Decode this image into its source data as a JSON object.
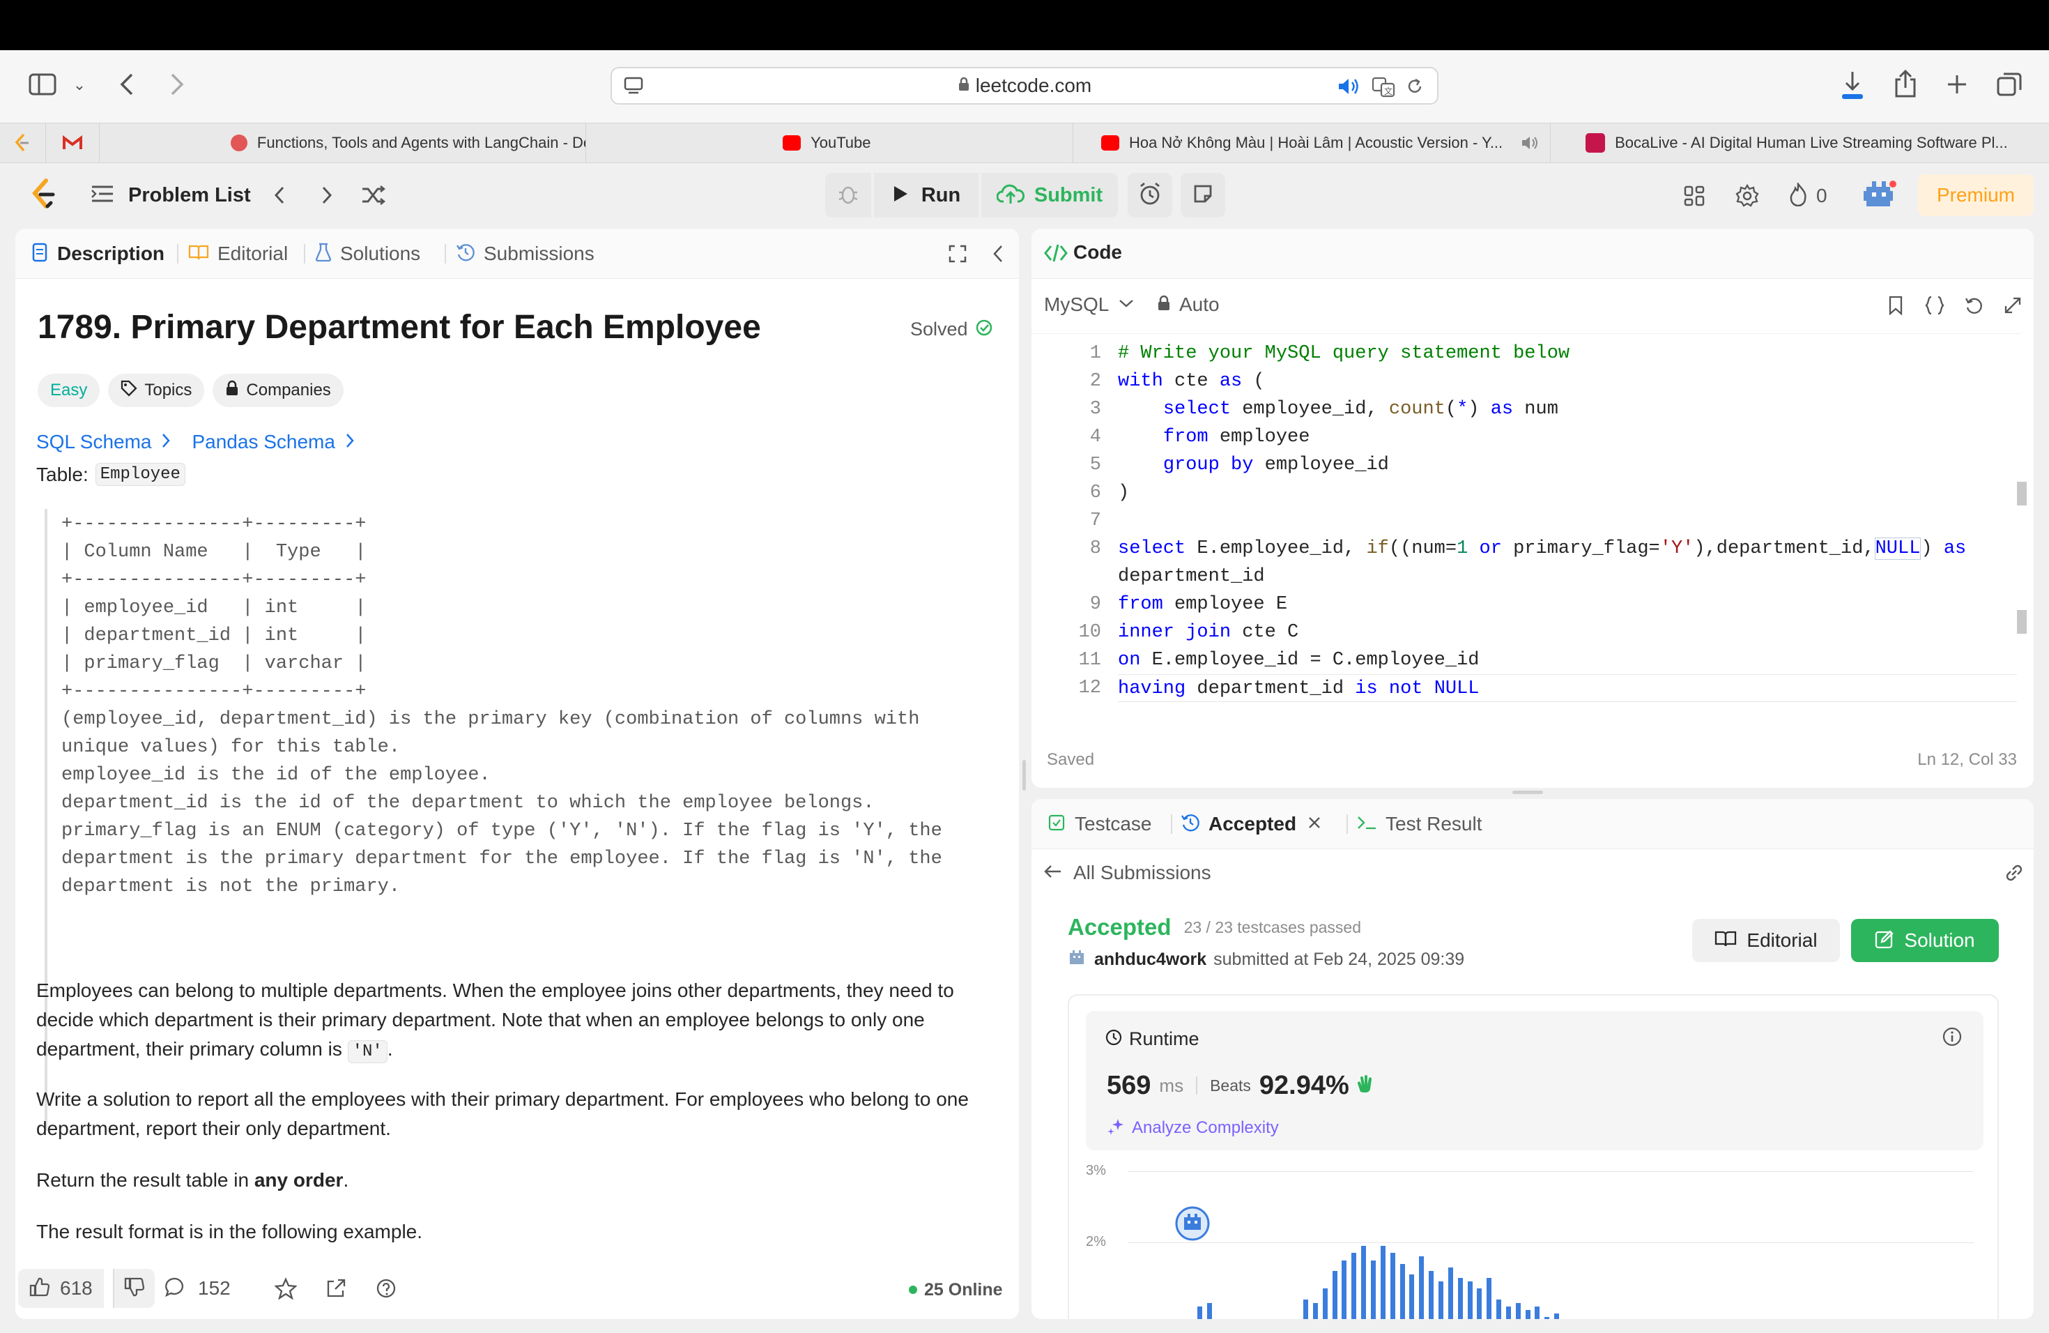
{
  "browser": {
    "url": "leetcode.com",
    "tabs": [
      {
        "label": "Functions, Tools and Agents with LangChain - DeepLear...",
        "color": "#e25656"
      },
      {
        "label": "YouTube",
        "color": "#ff0000"
      },
      {
        "label": "Hoa Nở Không Màu | Hoài Lâm | Acoustic Version - Y...",
        "color": "#ff0000"
      },
      {
        "label": "BocaLive - AI Digital Human Live Streaming Software Pl...",
        "color": "#c4164b"
      }
    ]
  },
  "nav": {
    "problem_list": "Problem List",
    "run": "Run",
    "submit": "Submit",
    "streak": "0",
    "premium": "Premium"
  },
  "left": {
    "tabs": [
      "Description",
      "Editorial",
      "Solutions",
      "Submissions"
    ],
    "title": "1789. Primary Department for Each Employee",
    "solved": "Solved",
    "difficulty": "Easy",
    "topics": "Topics",
    "companies": "Companies",
    "sql_schema": "SQL Schema",
    "pandas_schema": "Pandas Schema",
    "table_label": "Table:",
    "table_name": "Employee",
    "schema_lines": [
      "+---------------+---------+",
      "| Column Name   |  Type   |",
      "+---------------+---------+",
      "| employee_id   | int     |",
      "| department_id | int     |",
      "| primary_flag  | varchar |",
      "+---------------+---------+",
      "(employee_id, department_id) is the primary key (combination of columns with",
      "unique values) for this table.",
      "employee_id is the id of the employee.",
      "department_id is the id of the department to which the employee belongs.",
      "primary_flag is an ENUM (category) of type ('Y', 'N'). If the flag is 'Y', the",
      "department is the primary department for the employee. If the flag is 'N', the",
      "department is not the primary."
    ],
    "para1": "Employees can belong to multiple departments. When the employee joins other departments, they need to decide which department is their primary department. Note that when an employee belongs to only one department, their primary column is",
    "para1_code": "'N'",
    "para2": "Write a solution to report all the employees with their primary department. For employees who belong to one department, report their only department.",
    "para3_pre": "Return the result table in ",
    "para3_bold": "any order",
    "para3_post": ".",
    "para4": "The result format is in the following example.",
    "likes": "618",
    "comments": "152",
    "online": "25 Online"
  },
  "code": {
    "header": "Code",
    "language": "MySQL",
    "mode": "Auto",
    "saved": "Saved",
    "position": "Ln 12, Col 33",
    "line_numbers": [
      "1",
      "2",
      "3",
      "4",
      "5",
      "6",
      "7",
      "8",
      "",
      "9",
      "10",
      "11",
      "12"
    ]
  },
  "result": {
    "tab_testcase": "Testcase",
    "tab_accepted": "Accepted",
    "tab_result": "Test Result",
    "all_submissions": "All Submissions",
    "status": "Accepted",
    "passed": "23 / 23 testcases passed",
    "user": "anhduc4work",
    "submitted": "submitted at Feb 24, 2025 09:39",
    "editorial": "Editorial",
    "solution": "Solution",
    "runtime_label": "Runtime",
    "runtime_value": "569",
    "runtime_unit": "ms",
    "beats_label": "Beats",
    "beats_value": "92.94%",
    "analyze": "Analyze Complexity",
    "y_ticks": [
      "3%",
      "2%"
    ]
  },
  "chart_data": {
    "type": "bar",
    "title": "",
    "ylabel": "",
    "y_ticks": [
      "3%",
      "2%"
    ],
    "values": [
      0.45,
      0.85,
      1.1,
      1.15,
      0.3,
      0,
      0,
      0,
      0,
      0,
      0,
      0,
      0.55,
      1.2,
      1.15,
      1.35,
      1.6,
      1.75,
      1.85,
      1.95,
      1.75,
      1.95,
      1.85,
      1.7,
      1.55,
      1.8,
      1.6,
      1.45,
      1.65,
      1.5,
      1.45,
      1.35,
      1.5,
      1.2,
      1.1,
      1.15,
      1.05,
      1.1,
      0.95,
      1.0,
      0.85,
      0.9,
      0.8,
      0.7,
      0.75,
      0.5,
      0.55,
      0.6,
      0.45,
      0.35,
      0,
      0.3
    ]
  },
  "colors": {
    "accent_green": "#2db55d",
    "link_blue": "#1a73e8",
    "easy_teal": "#00af9b",
    "premium_orange": "#ffa116",
    "bar_blue": "#3b7ddd"
  }
}
